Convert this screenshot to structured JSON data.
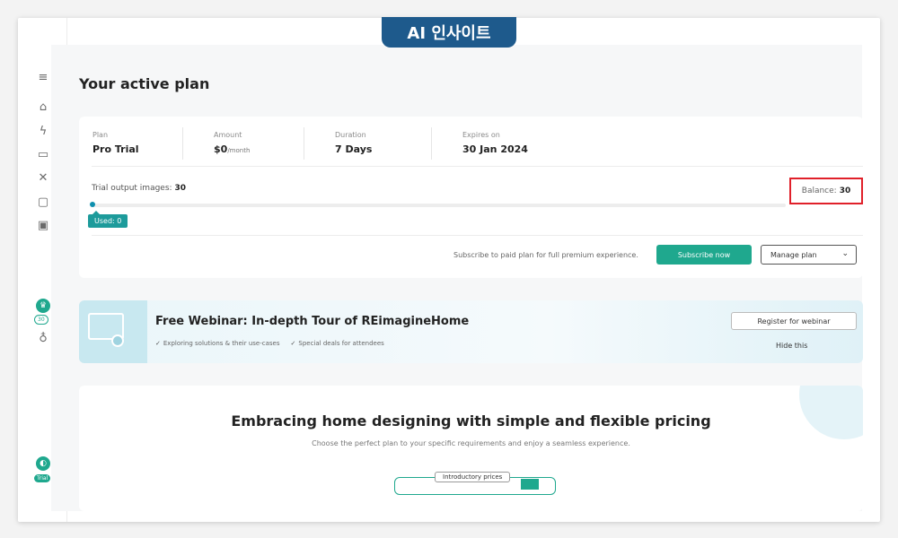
{
  "banner": {
    "text": "AI 인사이트"
  },
  "sidebar": {
    "icons": [
      "menu-icon",
      "home-icon",
      "lightning-icon",
      "folder-icon",
      "tools-icon",
      "chat-icon",
      "gallery-icon",
      "crown-icon",
      "moneybag-icon",
      "user-avatar-icon"
    ],
    "credits_chip": "30",
    "trial_chip": "Trial"
  },
  "page": {
    "title": "Your active plan"
  },
  "plan": {
    "plan_label": "Plan",
    "plan_value": "Pro Trial",
    "amount_label": "Amount",
    "amount_value": "$0",
    "amount_unit": "/month",
    "duration_label": "Duration",
    "duration_value": "7 Days",
    "expires_label": "Expires on",
    "expires_value": "30 Jan 2024",
    "trial_output_label": "Trial output images:",
    "trial_output_value": "30",
    "balance_label": "Balance:",
    "balance_value": "30",
    "used_label": "Used: 0",
    "used_fraction": 0,
    "subscribe_text": "Subscribe to paid plan for full premium experience.",
    "subscribe_button": "Subscribe now",
    "manage_button": "Manage plan"
  },
  "webinar": {
    "title": "Free Webinar: In-depth Tour of REimagineHome",
    "points": [
      "Exploring solutions & their use-cases",
      "Special deals for attendees"
    ],
    "register_button": "Register for webinar",
    "hide_link": "Hide this"
  },
  "pricing": {
    "title": "Embracing home designing with simple and flexible pricing",
    "subtitle": "Choose the perfect plan to your specific requirements and enjoy a seamless experience.",
    "intro_label": "Introductory prices"
  },
  "colors": {
    "accent": "#1fa88e",
    "highlight": "#e0202a",
    "banner": "#1e5a8c"
  }
}
